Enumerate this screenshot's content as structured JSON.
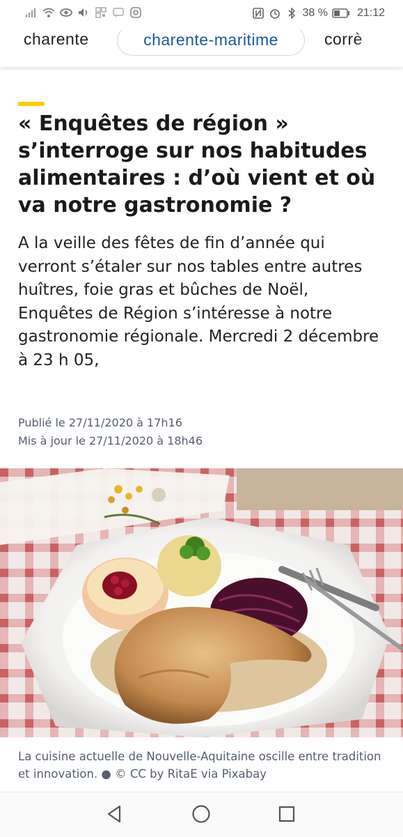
{
  "status_bar": {
    "battery_percent": "38 %",
    "time": "21:12",
    "icons": [
      "signal-icon",
      "wifi-icon",
      "eye-icon",
      "volume-icon",
      "qr-icon",
      "chat-icon",
      "instagram-icon",
      "nfc-icon",
      "alarm-icon",
      "bluetooth-icon",
      "battery-icon"
    ]
  },
  "tabs": {
    "items": [
      {
        "label": "charente"
      },
      {
        "label": "charente-maritime",
        "active": true
      },
      {
        "label": "corrè"
      }
    ],
    "active_color": "#1a57a8"
  },
  "article": {
    "accent_color": "#fecb00",
    "title": "« Enquêtes de région » s’interroge sur nos habitudes alimentaires : d’où vient et où va notre gastronomie ?",
    "lead": "A la veille des fêtes de fin d’année qui verront s’étaler sur nos tables entre autres huîtres, foie gras et bûches de Noël, Enquêtes de Région s’intéresse à notre gastronomie régionale. Mercredi 2 décembre à 23 h 05,",
    "published": "Publié le 27/11/2020 à 17h16",
    "updated": "Mis à jour le 27/11/2020 à 18h46"
  },
  "photo": {
    "caption": "La cuisine actuelle de Nouvelle-Aquitaine oscille entre tradition et innovation. ● © CC by RitaE via Pixabay"
  },
  "nav_bar": {
    "buttons": [
      "back-icon",
      "home-icon",
      "recents-icon"
    ]
  }
}
